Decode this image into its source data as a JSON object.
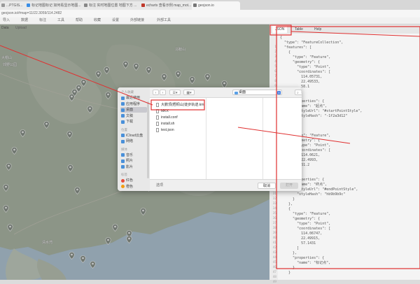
{
  "browser": {
    "tabs": [
      {
        "label": "...PTGIS..."
      },
      {
        "label": "标记地图标记 如何看显示地图..."
      },
      {
        "label": "标注 实时地图位置 地图下方 ..."
      },
      {
        "label": "echarts 查看示例 map_mot..."
      },
      {
        "label": "geojson.io"
      }
    ],
    "address": "geojson.io/#map=11/22.3059/114.2482",
    "bookmarks": [
      "导入",
      "数据",
      "标注",
      "工具",
      "帮助",
      "收藏",
      "设置",
      "外部链接",
      "外部工具"
    ]
  },
  "map": {
    "toolbar": [
      "Data",
      "Upload"
    ],
    "labels": [
      "大帽山",
      "郊野公园",
      "马鞍山",
      "清水湾"
    ]
  },
  "editor": {
    "tabs": [
      "JSON",
      "Table",
      "Help"
    ],
    "line_numbers": [
      "1",
      "2",
      "3",
      "4",
      "5",
      "6",
      "7",
      "8",
      "9",
      "10",
      "11",
      "12",
      "13",
      "14",
      "15",
      "16",
      "17",
      "18",
      "19",
      "20",
      "21",
      "22",
      "23",
      "24",
      "25",
      "26",
      "27",
      "28",
      "29",
      "30",
      "31",
      "32",
      "33",
      "34",
      "35",
      "36",
      "37",
      "38",
      "39",
      "40",
      "41",
      "42",
      "43",
      "44",
      "45",
      "46",
      "47",
      "48",
      "49",
      "50"
    ],
    "code_lines": [
      "{",
      "  \"type\": \"FeatureCollection\",",
      "  \"features\": [",
      "    {",
      "      \"type\": \"Feature\",",
      "      \"geometry\": {",
      "        \"type\": \"Point\",",
      "        \"coordinates\": [",
      "          114.05731,",
      "          22.49533,",
      "          58.1",
      "        ]",
      "      },",
      "      \"properties\": {",
      "        \"name\": \"起点\",",
      "        \"styleUrl\": \"#startPointStyle\",",
      "        \"styleHash\": \"-1f2a3d12\"",
      "      }",
      "    },",
      "    {",
      "      \"type\": \"Feature\",",
      "      \"geometry\": {",
      "        \"type\": \"Point\",",
      "        \"coordinates\": [",
      "          114.0621,",
      "          22.4993,",
      "          61.2",
      "        ]",
      "      },",
      "      \"properties\": {",
      "        \"name\": \"终点\",",
      "        \"styleUrl\": \"#endPointStyle\",",
      "        \"styleHash\": \"hb9b9b9c\"",
      "      }",
      "    },",
      "    {",
      "      \"type\": \"Feature\",",
      "      \"geometry\": {",
      "        \"type\": \"Point\",",
      "        \"coordinates\": [",
      "          114.06747,",
      "          22.49915,",
      "          57.1431",
      "        ]",
      "      },",
      "      \"properties\": {",
      "        \"name\": \"标记点\",",
      "      }",
      "    }",
      "  ]"
    ]
  },
  "dialog": {
    "sidebar_sections": [
      {
        "heading": "个人收藏",
        "items": [
          "最近使用",
          "应用程序",
          "桌面",
          "文稿",
          "下载"
        ]
      },
      {
        "heading": "位置",
        "items": [
          "iCloud云盘",
          "网络"
        ]
      },
      {
        "heading": "媒体",
        "items": [
          "音乐",
          "照片",
          "影片"
        ]
      },
      {
        "heading": "标签",
        "items": [
          "红色",
          "橙色"
        ]
      }
    ],
    "selected_sidebar": "桌面",
    "path_label": "桌面",
    "search_placeholder": "搜索",
    "files": [
      {
        "name": "大鹏顶(梧桐山)徒步轨迹.kml",
        "selected": true
      },
      {
        "name": "MKX"
      },
      {
        "name": "install.conf"
      },
      {
        "name": "install.sh"
      },
      {
        "name": "test.json"
      }
    ],
    "options_label": "选项",
    "cancel_label": "取消",
    "open_label": "打开"
  }
}
